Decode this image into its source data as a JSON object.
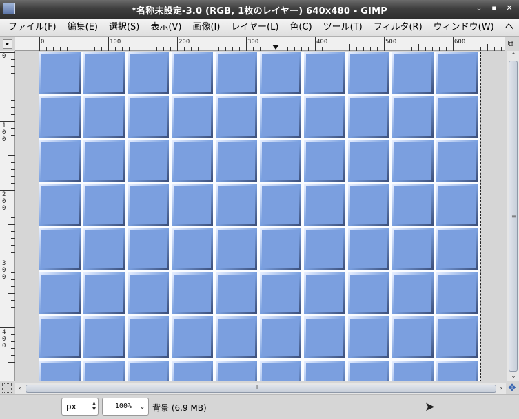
{
  "window": {
    "title": "*名称未設定-3.0 (RGB, 1枚のレイヤー) 640x480 - GIMP",
    "controls": [
      "⌄",
      "▪",
      "✕"
    ]
  },
  "menu": [
    {
      "label": "ファイル(F)"
    },
    {
      "label": "編集(E)"
    },
    {
      "label": "選択(S)"
    },
    {
      "label": "表示(V)"
    },
    {
      "label": "画像(I)"
    },
    {
      "label": "レイヤー(L)"
    },
    {
      "label": "色(C)"
    },
    {
      "label": "ツール(T)"
    },
    {
      "label": "フィルタ(R)"
    },
    {
      "label": "ウィンドウ(W)"
    },
    {
      "label": "ヘ"
    }
  ],
  "rulers": {
    "horizontal": [
      "0",
      "100",
      "200",
      "300",
      "400",
      "500",
      "600"
    ],
    "vertical": [
      "0",
      "100",
      "200",
      "300",
      "400"
    ]
  },
  "canvas": {
    "image_width": 640,
    "image_height": 480,
    "tile_color": "#7b9fdf",
    "highlight_color": "#fafcff"
  },
  "status": {
    "unit": "px",
    "zoom": "100%",
    "info": "背景 (6.9 MB)"
  },
  "icons": {
    "quick_mask": "quick-mask-icon",
    "navigate": "navigate-icon",
    "pointer": "mouse-pointer-icon"
  }
}
